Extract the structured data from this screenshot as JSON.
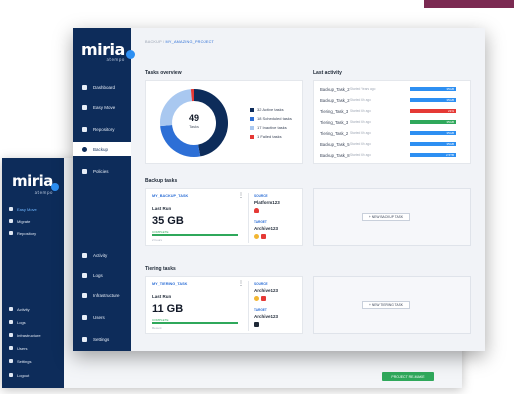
{
  "back_window": {
    "brand": "miria",
    "brand_sub": "atempo",
    "nav": [
      {
        "label": "Easy Move",
        "active": true
      },
      {
        "label": "Migrate",
        "active": false
      },
      {
        "label": "Repository",
        "active": false
      },
      {
        "label": "Activity",
        "active": false
      },
      {
        "label": "Logs",
        "active": false
      },
      {
        "label": "Infrastructure",
        "active": false
      },
      {
        "label": "Users",
        "active": false
      },
      {
        "label": "Settings",
        "active": false
      },
      {
        "label": "Logout",
        "active": false
      }
    ],
    "button_label": "PROJECT RE-MAKE"
  },
  "sidebar": {
    "brand": "miria",
    "brand_sub": "atempo",
    "items": [
      {
        "label": "Dashboard",
        "icon": "grid-icon",
        "active": false
      },
      {
        "label": "Easy Move",
        "icon": "arrow-right-icon",
        "active": false
      },
      {
        "label": "Repository",
        "icon": "box-icon",
        "active": false
      },
      {
        "label": "Backup",
        "icon": "refresh-icon",
        "active": true
      },
      {
        "label": "Policies",
        "icon": "tools-icon",
        "active": false
      },
      {
        "label": "Activity",
        "icon": "bell-icon",
        "active": false
      },
      {
        "label": "Logs",
        "icon": "log-icon",
        "active": false
      },
      {
        "label": "Infrastructure",
        "icon": "server-icon",
        "active": false
      },
      {
        "label": "Users",
        "icon": "users-icon",
        "active": false
      },
      {
        "label": "Settings",
        "icon": "gear-icon",
        "active": false
      }
    ]
  },
  "breadcrumb": {
    "prefix": "BACKUP /",
    "current": "MY_AMAZING_PROJECT"
  },
  "tasks_overview": {
    "title": "Tasks overview",
    "total_value": "49",
    "total_label": "Tasks",
    "legend": [
      {
        "label": "32 Active tasks",
        "value": 32,
        "color": "#0d2c5a"
      },
      {
        "label": "18 Scheduled tasks",
        "value": 18,
        "color": "#2d6fd6"
      },
      {
        "label": "17 Inactive tasks",
        "value": 17,
        "color": "#a9c8f0"
      },
      {
        "label": "1 Failed tasks",
        "value": 1,
        "color": "#e53935"
      }
    ]
  },
  "last_activity": {
    "title": "Last activity",
    "rows": [
      {
        "name": "Backup_Task_2",
        "time": "Started Years ago",
        "status": "In progress",
        "value": "35GB",
        "color": "#2d8ff2"
      },
      {
        "name": "Backup_Task_2",
        "time": "Started 6h ago",
        "status": "In progress",
        "value": "35GB",
        "color": "#2d8ff2"
      },
      {
        "name": "Tiering_Task_3",
        "time": "Started 6h ago",
        "status": "Error",
        "value": "21%",
        "color": "#e53935"
      },
      {
        "name": "Tiering_Task_3",
        "time": "Started 6h ago",
        "status": "Completed",
        "value": "35GB",
        "color": "#2fa85b"
      },
      {
        "name": "Tiering_Task_2",
        "time": "Started 6h ago",
        "status": "In progress",
        "value": "35GB",
        "color": "#2d8ff2"
      },
      {
        "name": "Backup_Task_5",
        "time": "Started 6h ago",
        "status": "In progress",
        "value": "35GB",
        "color": "#2d8ff2"
      },
      {
        "name": "Backup_Task_8",
        "time": "Started 6h ago",
        "status": "In progress",
        "value": "2.5TB",
        "color": "#2d8ff2"
      }
    ]
  },
  "backup_tasks": {
    "title": "Backup tasks",
    "card": {
      "name": "MY_BACKUP_TASK",
      "last_run_label": "Last Run",
      "size": "35 GB",
      "status": "COMPLETE",
      "progress": 1.0,
      "when": "2 hours",
      "source_label": "SOURCE",
      "source": "Platform123",
      "target_label": "TARGET",
      "target": "Archive123"
    },
    "add_label": "NEW BACKUP TASK"
  },
  "tiering_tasks": {
    "title": "Tiering tasks",
    "card": {
      "name": "MY_TIERING_TASK",
      "last_run_label": "Last Run",
      "size": "11 GB",
      "status": "COMPLETE",
      "progress": 1.0,
      "when": "Recent",
      "source_label": "SOURCE",
      "source": "Archive123",
      "target_label": "TARGET",
      "target": "Archive123"
    },
    "add_label": "NEW TIERING TASK"
  }
}
